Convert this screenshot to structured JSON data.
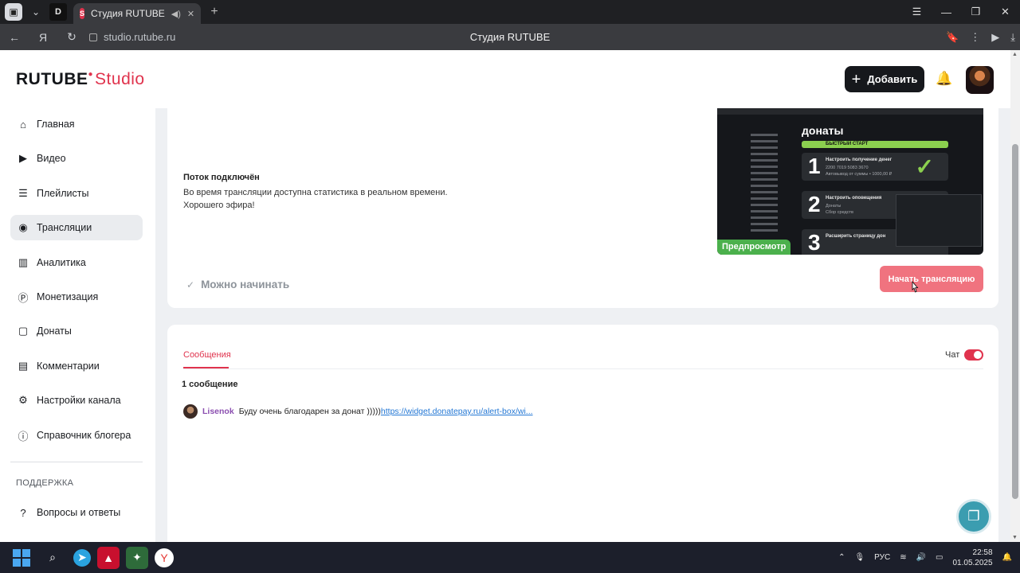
{
  "browser": {
    "pinned_tab_label": "D",
    "tab_title": "Студия RUTUBE",
    "url": "studio.rutube.ru",
    "page_title": "Студия RUTUBE"
  },
  "header": {
    "logo_main": "RUTUBE",
    "logo_studio": "Studio",
    "add_label": "Добавить"
  },
  "sidebar": {
    "items": [
      {
        "label": "Главная",
        "icon": "home-icon"
      },
      {
        "label": "Видео",
        "icon": "video-icon"
      },
      {
        "label": "Плейлисты",
        "icon": "playlist-icon"
      },
      {
        "label": "Трансляции",
        "icon": "broadcast-icon"
      },
      {
        "label": "Аналитика",
        "icon": "analytics-icon"
      },
      {
        "label": "Монетизация",
        "icon": "monetization-icon"
      },
      {
        "label": "Донаты",
        "icon": "donations-icon"
      },
      {
        "label": "Комментарии",
        "icon": "comments-icon"
      },
      {
        "label": "Настройки канала",
        "icon": "settings-icon"
      },
      {
        "label": "Справочник блогера",
        "icon": "info-icon"
      }
    ],
    "support_section": "ПОДДЕРЖКА",
    "support_items": [
      {
        "label": "Вопросы и ответы",
        "icon": "help-icon"
      }
    ]
  },
  "stream": {
    "title": "Поток подключён",
    "desc_line1": "Во время трансляции доступна статистика в реальном времени.",
    "desc_line2": "Хорошего эфира!",
    "ready_label": "Можно начинать",
    "preview_label": "Предпросмотр",
    "start_label": "Начать трансляцию",
    "preview_content": {
      "heading": "донаты",
      "quick_start": "БЫСТРЫЙ СТАРТ",
      "step1_num": "1",
      "step1_title": "Настроить получение денег",
      "step1_sub1": "2200 7019 5083 3670",
      "step1_sub2": "Автовывод от суммы • 1000,00 ₽",
      "step2_num": "2",
      "step2_title": "Настроить оповещения",
      "step2_sub1": "Донаты",
      "step2_sub2": "Сбор средств",
      "step3_num": "3",
      "step3_title": "Расширить страницу дон"
    }
  },
  "chat": {
    "tab_label": "Сообщения",
    "toggle_label": "Чат",
    "toggle_on": true,
    "count_label": "1 сообщение",
    "messages": [
      {
        "user": "Lisenok",
        "text": "Буду очень благодарен за донат )))))",
        "link": "https://widget.donatepay.ru/alert-box/wi..."
      }
    ]
  },
  "taskbar": {
    "lang": "РУС",
    "time": "22:58",
    "date": "01.05.2025"
  },
  "colors": {
    "accent": "#e0334d",
    "start_button": "#f0737f",
    "preview_badge": "#4bb04c",
    "help_fab": "#3b9db0"
  }
}
